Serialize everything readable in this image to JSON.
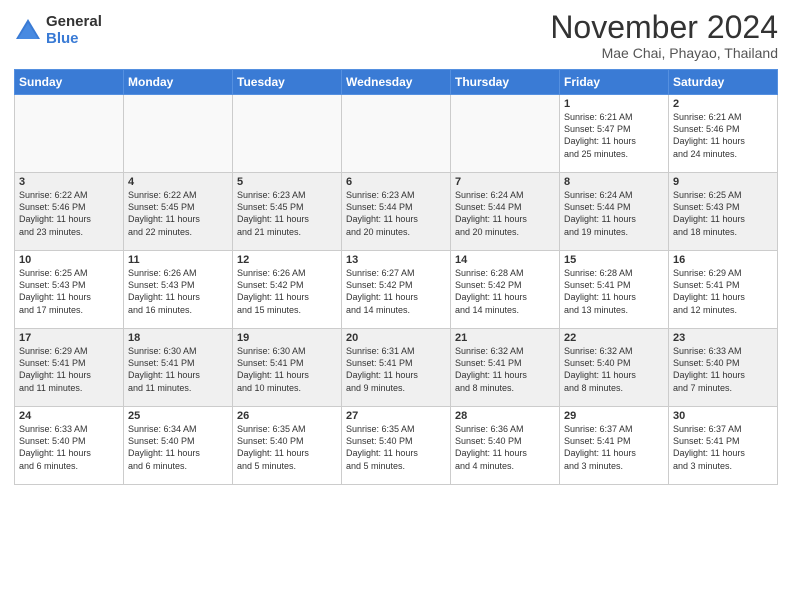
{
  "header": {
    "logo_general": "General",
    "logo_blue": "Blue",
    "month_title": "November 2024",
    "location": "Mae Chai, Phayao, Thailand"
  },
  "weekdays": [
    "Sunday",
    "Monday",
    "Tuesday",
    "Wednesday",
    "Thursday",
    "Friday",
    "Saturday"
  ],
  "weeks": [
    [
      {
        "day": "",
        "info": ""
      },
      {
        "day": "",
        "info": ""
      },
      {
        "day": "",
        "info": ""
      },
      {
        "day": "",
        "info": ""
      },
      {
        "day": "",
        "info": ""
      },
      {
        "day": "1",
        "info": "Sunrise: 6:21 AM\nSunset: 5:47 PM\nDaylight: 11 hours\nand 25 minutes."
      },
      {
        "day": "2",
        "info": "Sunrise: 6:21 AM\nSunset: 5:46 PM\nDaylight: 11 hours\nand 24 minutes."
      }
    ],
    [
      {
        "day": "3",
        "info": "Sunrise: 6:22 AM\nSunset: 5:46 PM\nDaylight: 11 hours\nand 23 minutes."
      },
      {
        "day": "4",
        "info": "Sunrise: 6:22 AM\nSunset: 5:45 PM\nDaylight: 11 hours\nand 22 minutes."
      },
      {
        "day": "5",
        "info": "Sunrise: 6:23 AM\nSunset: 5:45 PM\nDaylight: 11 hours\nand 21 minutes."
      },
      {
        "day": "6",
        "info": "Sunrise: 6:23 AM\nSunset: 5:44 PM\nDaylight: 11 hours\nand 20 minutes."
      },
      {
        "day": "7",
        "info": "Sunrise: 6:24 AM\nSunset: 5:44 PM\nDaylight: 11 hours\nand 20 minutes."
      },
      {
        "day": "8",
        "info": "Sunrise: 6:24 AM\nSunset: 5:44 PM\nDaylight: 11 hours\nand 19 minutes."
      },
      {
        "day": "9",
        "info": "Sunrise: 6:25 AM\nSunset: 5:43 PM\nDaylight: 11 hours\nand 18 minutes."
      }
    ],
    [
      {
        "day": "10",
        "info": "Sunrise: 6:25 AM\nSunset: 5:43 PM\nDaylight: 11 hours\nand 17 minutes."
      },
      {
        "day": "11",
        "info": "Sunrise: 6:26 AM\nSunset: 5:43 PM\nDaylight: 11 hours\nand 16 minutes."
      },
      {
        "day": "12",
        "info": "Sunrise: 6:26 AM\nSunset: 5:42 PM\nDaylight: 11 hours\nand 15 minutes."
      },
      {
        "day": "13",
        "info": "Sunrise: 6:27 AM\nSunset: 5:42 PM\nDaylight: 11 hours\nand 14 minutes."
      },
      {
        "day": "14",
        "info": "Sunrise: 6:28 AM\nSunset: 5:42 PM\nDaylight: 11 hours\nand 14 minutes."
      },
      {
        "day": "15",
        "info": "Sunrise: 6:28 AM\nSunset: 5:41 PM\nDaylight: 11 hours\nand 13 minutes."
      },
      {
        "day": "16",
        "info": "Sunrise: 6:29 AM\nSunset: 5:41 PM\nDaylight: 11 hours\nand 12 minutes."
      }
    ],
    [
      {
        "day": "17",
        "info": "Sunrise: 6:29 AM\nSunset: 5:41 PM\nDaylight: 11 hours\nand 11 minutes."
      },
      {
        "day": "18",
        "info": "Sunrise: 6:30 AM\nSunset: 5:41 PM\nDaylight: 11 hours\nand 11 minutes."
      },
      {
        "day": "19",
        "info": "Sunrise: 6:30 AM\nSunset: 5:41 PM\nDaylight: 11 hours\nand 10 minutes."
      },
      {
        "day": "20",
        "info": "Sunrise: 6:31 AM\nSunset: 5:41 PM\nDaylight: 11 hours\nand 9 minutes."
      },
      {
        "day": "21",
        "info": "Sunrise: 6:32 AM\nSunset: 5:41 PM\nDaylight: 11 hours\nand 8 minutes."
      },
      {
        "day": "22",
        "info": "Sunrise: 6:32 AM\nSunset: 5:40 PM\nDaylight: 11 hours\nand 8 minutes."
      },
      {
        "day": "23",
        "info": "Sunrise: 6:33 AM\nSunset: 5:40 PM\nDaylight: 11 hours\nand 7 minutes."
      }
    ],
    [
      {
        "day": "24",
        "info": "Sunrise: 6:33 AM\nSunset: 5:40 PM\nDaylight: 11 hours\nand 6 minutes."
      },
      {
        "day": "25",
        "info": "Sunrise: 6:34 AM\nSunset: 5:40 PM\nDaylight: 11 hours\nand 6 minutes."
      },
      {
        "day": "26",
        "info": "Sunrise: 6:35 AM\nSunset: 5:40 PM\nDaylight: 11 hours\nand 5 minutes."
      },
      {
        "day": "27",
        "info": "Sunrise: 6:35 AM\nSunset: 5:40 PM\nDaylight: 11 hours\nand 5 minutes."
      },
      {
        "day": "28",
        "info": "Sunrise: 6:36 AM\nSunset: 5:40 PM\nDaylight: 11 hours\nand 4 minutes."
      },
      {
        "day": "29",
        "info": "Sunrise: 6:37 AM\nSunset: 5:41 PM\nDaylight: 11 hours\nand 3 minutes."
      },
      {
        "day": "30",
        "info": "Sunrise: 6:37 AM\nSunset: 5:41 PM\nDaylight: 11 hours\nand 3 minutes."
      }
    ]
  ]
}
